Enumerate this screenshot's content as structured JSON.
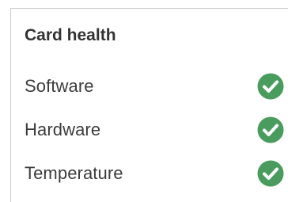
{
  "card": {
    "title": "Card health",
    "items": [
      {
        "label": "Software",
        "status": "ok",
        "icon": "check-circle-icon"
      },
      {
        "label": "Hardware",
        "status": "ok",
        "icon": "check-circle-icon"
      },
      {
        "label": "Temperature",
        "status": "ok",
        "icon": "check-circle-icon"
      }
    ]
  },
  "colors": {
    "ok": "#4a9c5e",
    "text": "#3c3c3c",
    "border": "#c8c8c8"
  }
}
